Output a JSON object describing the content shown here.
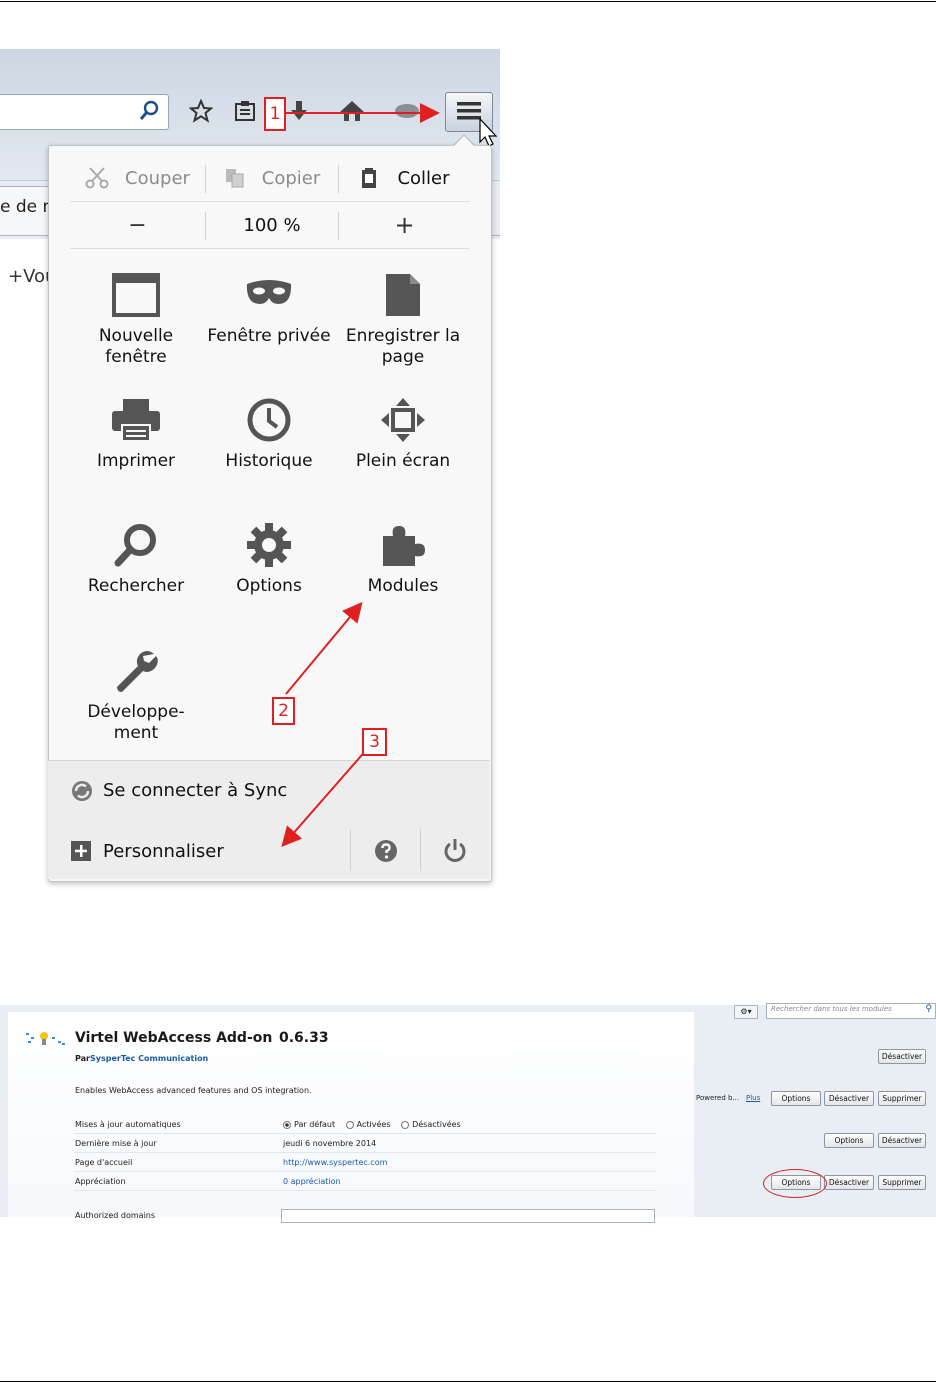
{
  "browser": {
    "tab_label": "e de m",
    "page_text": "+Vou",
    "menu_button_icon": "hamburger-icon"
  },
  "menu": {
    "edit": {
      "cut": "Couper",
      "copy": "Copier",
      "paste": "Coller"
    },
    "zoom": {
      "minus": "−",
      "level": "100 %",
      "plus": "+"
    },
    "items": [
      {
        "label": "Nouvelle fenêtre",
        "icon": "window-icon"
      },
      {
        "label": "Fenêtre privée",
        "icon": "mask-icon"
      },
      {
        "label": "Enregistrer la page",
        "icon": "page-icon"
      },
      {
        "label": "Imprimer",
        "icon": "printer-icon"
      },
      {
        "label": "Historique",
        "icon": "clock-icon"
      },
      {
        "label": "Plein écran",
        "icon": "fullscreen-icon"
      },
      {
        "label": "Rechercher",
        "icon": "search-icon"
      },
      {
        "label": "Options",
        "icon": "gear-icon"
      },
      {
        "label": "Modules",
        "icon": "puzzle-icon"
      },
      {
        "label": "Développe-ment",
        "icon": "wrench-icon"
      }
    ],
    "sync_label": "Se connecter à Sync",
    "customize_label": "Personnaliser"
  },
  "annotations": {
    "one": "1",
    "two": "2",
    "three": "3",
    "color": "#e02020"
  },
  "addon": {
    "title": "Virtel WebAccess Add-on",
    "version": "0.6.33",
    "by_prefix": "Par",
    "author": "SysperTec Communication",
    "description": "Enables WebAccess advanced features and OS integration.",
    "search_placeholder": "Rechercher dans tous les modules",
    "rows": [
      {
        "label": "Mises à jour automatiques",
        "value": ""
      },
      {
        "label": "Dernière mise à jour",
        "value": "jeudi 6 novembre 2014"
      },
      {
        "label": "Page d'accueil",
        "value": "http://www.syspertec.com"
      },
      {
        "label": "Appréciation",
        "value": "0 appréciation"
      },
      {
        "label": "Authorized domains",
        "value": ""
      }
    ],
    "radio_options": [
      "Par défaut",
      "Activées",
      "Désactivées"
    ],
    "powered_text": "Powered b...",
    "plus_link": "Plus",
    "btn_options": "Options",
    "btn_disable": "Désactiver",
    "btn_remove": "Supprimer"
  }
}
